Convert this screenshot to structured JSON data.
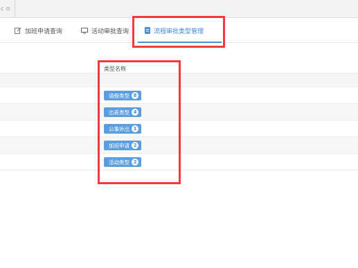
{
  "colors": {
    "accent": "#4a8fd8",
    "tag_bg": "#5b9ee0",
    "highlight": "#ee3a3a"
  },
  "topbar": {
    "fragment": "c ⊙"
  },
  "tabs": [
    {
      "label": "加班申请查询",
      "icon": "edit-icon",
      "active": false
    },
    {
      "label": "活动审批查询",
      "icon": "monitor-icon",
      "active": false
    },
    {
      "label": "流程审批类型管理",
      "icon": "document-icon",
      "active": true
    }
  ],
  "table": {
    "header": "类型名称",
    "rows": [
      {
        "label": "请假类型",
        "count": "8"
      },
      {
        "label": "出差类型",
        "count": "4"
      },
      {
        "label": "公事外出",
        "count": "1"
      },
      {
        "label": "加班申请",
        "count": "2"
      },
      {
        "label": "活动类型",
        "count": "2"
      }
    ]
  }
}
